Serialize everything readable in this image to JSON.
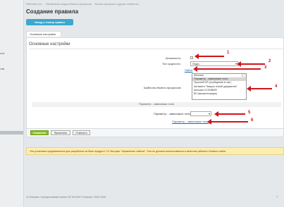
{
  "sidebar": {
    "frag1": "сса",
    "frag2": "тов"
  },
  "breadcrumbs": [
    "Рабочий стол",
    "Обновление модуля бизнес-процессов",
    "Бизнес-процессы и другие элементы"
  ],
  "page_title": "Создание правила",
  "back_button": "Назад к списку правил",
  "tab_main": "Основные настройки",
  "panel_title": "Основные настройки",
  "fields": {
    "active_label": "Активность:",
    "entity_label": "Тип сущности:",
    "entity_value": "Лиды",
    "open_link": "Найти",
    "templates_label": "Шаблоны бизнес-процессов:",
    "templates_options": [
      "Автозап",
      "Параметр - зависимые поля",
      "Простой БП (сообщение в чат)",
      "Активити \"Запрос полей документа\"",
      "Автозап УСЛОВИЯ",
      "БП (вышестоящие)"
    ],
    "templates_selected": 1
  },
  "separator_label": "Параметр - зависимые поля",
  "param_label": "Параметр - зависимые поля:",
  "param_value": "",
  "param_link": "Параметр - зависимые поля",
  "buttons": {
    "save": "Сохранить",
    "apply": "Применить",
    "cancel": "Отменить"
  },
  "warning": "Эта установка предназначена для разработки на базе продукта \"1С-Битрикс: Управление сайтом\". Она не должна использоваться в качестве рабочего боевого сайта",
  "footer": "1С-Битрикс: Корпоративный портал 25.100.600 © Битрикс, 2002-2025",
  "footer_right": "Т",
  "callouts": [
    "1",
    "2",
    "3",
    "4",
    "5",
    "6"
  ]
}
